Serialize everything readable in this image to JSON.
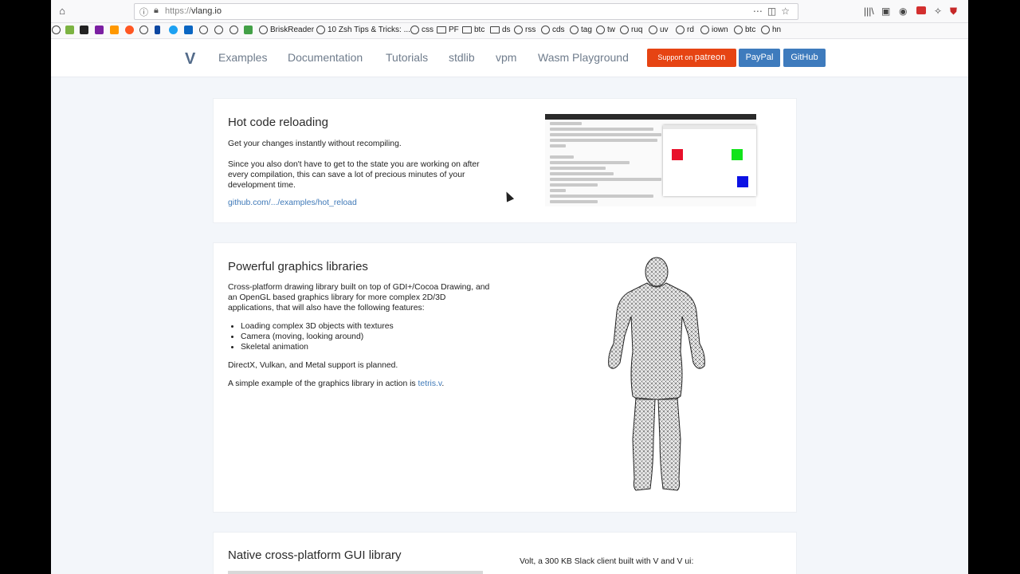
{
  "browser": {
    "url_scheme": "https://",
    "url_host": "vlang.io",
    "bookmarks": [
      "BriskReader",
      "10 Zsh Tips & Tricks: ...",
      "css",
      "PF",
      "btc",
      "ds",
      "rss",
      "cds",
      "tag",
      "tw",
      "ruq",
      "uv",
      "rd",
      "iown",
      "btc",
      "hn"
    ]
  },
  "site": {
    "logo": "V",
    "nav": [
      "Examples",
      "Documentation",
      "Tutorials",
      "stdlib",
      "vpm",
      "Wasm Playground"
    ],
    "support_label": "Support on",
    "patreon_label": "patreon",
    "paypal_label": "PayPal",
    "github_label": "GitHub"
  },
  "hot_reload": {
    "title": "Hot code reloading",
    "p1": "Get your changes instantly without recompiling.",
    "p2": "Since you also don't have to get to the state you are working on after every compilation, this can save a lot of precious minutes of your development time.",
    "link": "github.com/.../examples/hot_reload"
  },
  "graphics": {
    "title": "Powerful graphics libraries",
    "p1": "Cross-platform drawing library built on top of GDI+/Cocoa Drawing, and an OpenGL based graphics library for more complex 2D/3D applications, that will also have the following features:",
    "features": [
      "Loading complex 3D objects with textures",
      "Camera (moving, looking around)",
      "Skeletal animation"
    ],
    "p2": "DirectX, Vulkan, and Metal support is planned.",
    "p3_prefix": "A simple example of the graphics library in action is ",
    "p3_link": "tetris.v",
    "p3_suffix": "."
  },
  "gui": {
    "title": "Native cross-platform GUI library",
    "caption": "Volt, a 300 KB Slack client built with V and V ui:"
  },
  "colors": {
    "accent": "#3f79b8",
    "patreon": "#e64413",
    "button_blue": "#3e7bbd"
  }
}
